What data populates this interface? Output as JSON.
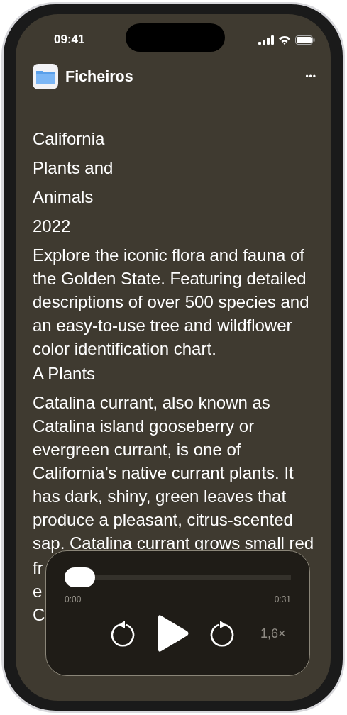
{
  "status_bar": {
    "time": "09:41"
  },
  "nav": {
    "title": "Ficheiros",
    "more": "•••"
  },
  "content": [
    {
      "kind": "title",
      "text": "California"
    },
    {
      "kind": "title",
      "text": "Plants and"
    },
    {
      "kind": "title",
      "text": "Animals"
    },
    {
      "kind": "title",
      "text": "2022"
    },
    {
      "kind": "paragraph",
      "text": "Explore the iconic flora and fauna of the Golden State. Featuring detailed descriptions of over 500 species and an easy-to-use tree and wildflower color identification chart."
    },
    {
      "kind": "title",
      "text": "A Plants"
    },
    {
      "kind": "paragraph",
      "text": "Catalina currant, also known as Catalina island gooseberry or evergreen currant, is one of California’s native currant plants. It has dark, shiny, green leaves that produce a pleasant, citrus-scented sap. Catalina currant grows small red"
    },
    {
      "kind": "fragment",
      "text": "fr"
    },
    {
      "kind": "fragment",
      "text": "e"
    },
    {
      "kind": "title",
      "text": "C"
    }
  ],
  "player": {
    "level": 0,
    "elapsed": "0:00",
    "total": "0:31",
    "speed": "1,6×",
    "playing": false
  }
}
